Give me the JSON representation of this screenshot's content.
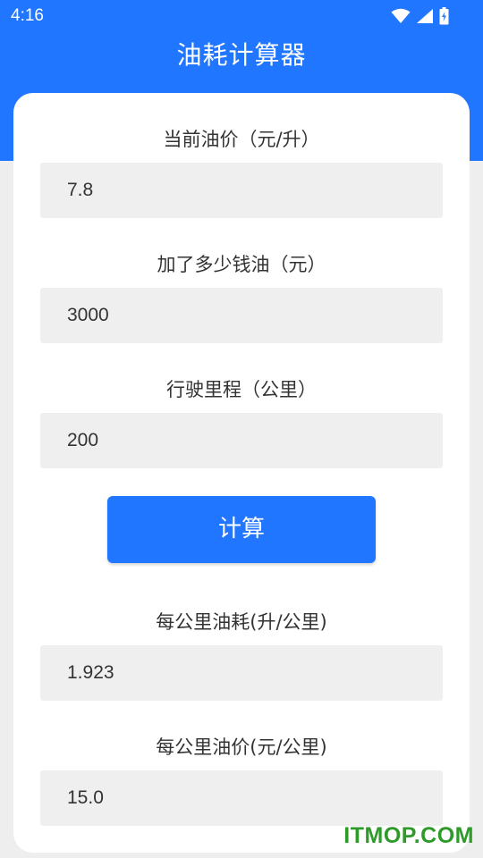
{
  "status_bar": {
    "time": "4:16"
  },
  "app": {
    "title": "油耗计算器"
  },
  "form": {
    "price_label": "当前油价（元/升）",
    "price_value": "7.8",
    "money_label": "加了多少钱油（元）",
    "money_value": "3000",
    "distance_label": "行驶里程（公里）",
    "distance_value": "200",
    "calculate_label": "计算"
  },
  "results": {
    "consumption_label": "每公里油耗(升/公里)",
    "consumption_value": "1.923",
    "cost_label": "每公里油价(元/公里)",
    "cost_value": "15.0"
  },
  "watermark": "ITMOP.COM",
  "colors": {
    "primary": "#2176ff",
    "background": "#eeeeee",
    "field": "#efefef",
    "watermark": "#2e9a2a"
  },
  "icons": [
    "wifi-icon",
    "cell-signal-icon",
    "battery-icon"
  ]
}
